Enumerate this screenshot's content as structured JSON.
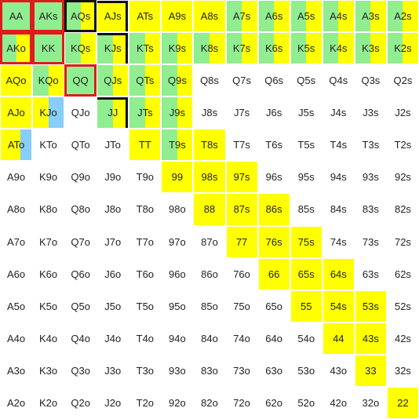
{
  "colors": {
    "yellow": "#ffff00",
    "green": "#90ee90",
    "blue": "#87cefa",
    "white": "#ffffff",
    "red_outline": "#e01b1b",
    "black_outline": "#111111"
  },
  "rows": [
    [
      {
        "label": "AA",
        "fill": [
          "green",
          1.0
        ],
        "outline": "red"
      },
      {
        "label": "AKs",
        "fill": [
          "green",
          1.0
        ],
        "outline": "red"
      },
      {
        "label": "AQs",
        "fill": [
          "green",
          0.5
        ],
        "base": "yellow",
        "outline": "black"
      },
      {
        "label": "AJs",
        "fill": null,
        "base": "yellow",
        "outline": "corner"
      },
      {
        "label": "ATs",
        "base": "yellow"
      },
      {
        "label": "A9s",
        "base": "yellow"
      },
      {
        "label": "A8s",
        "base": "yellow"
      },
      {
        "label": "A7s",
        "fill": [
          "green",
          0.5
        ],
        "base": "yellow"
      },
      {
        "label": "A6s",
        "fill": [
          "green",
          0.5
        ],
        "base": "yellow"
      },
      {
        "label": "A5s",
        "fill": [
          "green",
          0.5
        ],
        "base": "yellow"
      },
      {
        "label": "A4s",
        "fill": [
          "green",
          0.5
        ],
        "base": "yellow"
      },
      {
        "label": "A3s",
        "fill": [
          "green",
          0.5
        ],
        "base": "yellow"
      },
      {
        "label": "A2s",
        "fill": [
          "green",
          0.5
        ],
        "base": "yellow"
      }
    ],
    [
      {
        "label": "AKo",
        "fill": [
          "green",
          0.5
        ],
        "base": "yellow",
        "outline": "red"
      },
      {
        "label": "KK",
        "fill": [
          "green",
          1.0
        ],
        "outline": "red"
      },
      {
        "label": "KQs",
        "fill": [
          "green",
          0.5
        ],
        "base": "yellow"
      },
      {
        "label": "KJs",
        "fill": [
          "green",
          0.5
        ],
        "base": "yellow",
        "outline": "corner"
      },
      {
        "label": "KTs",
        "fill": [
          "green",
          0.5
        ],
        "base": "yellow"
      },
      {
        "label": "K9s",
        "fill": [
          "green",
          0.5
        ],
        "base": "yellow"
      },
      {
        "label": "K8s",
        "fill": [
          "green",
          0.5
        ],
        "base": "yellow"
      },
      {
        "label": "K7s",
        "fill": [
          "green",
          0.5
        ],
        "base": "yellow"
      },
      {
        "label": "K6s",
        "fill": [
          "green",
          0.5
        ],
        "base": "yellow"
      },
      {
        "label": "K5s",
        "fill": [
          "green",
          0.5
        ],
        "base": "yellow"
      },
      {
        "label": "K4s",
        "fill": [
          "green",
          0.5
        ],
        "base": "yellow"
      },
      {
        "label": "K3s",
        "fill": [
          "green",
          0.5
        ],
        "base": "yellow"
      },
      {
        "label": "K2s",
        "fill": [
          "green",
          0.5
        ],
        "base": "yellow"
      }
    ],
    [
      {
        "label": "AQo",
        "base": "yellow"
      },
      {
        "label": "KQo",
        "fill": [
          "green",
          0.5
        ],
        "base": "yellow"
      },
      {
        "label": "QQ",
        "fill": [
          "green",
          1.0
        ],
        "outline": "red"
      },
      {
        "label": "QJs",
        "fill": [
          "green",
          0.5
        ],
        "base": "yellow"
      },
      {
        "label": "QTs",
        "fill": [
          "green",
          0.5
        ],
        "base": "yellow"
      },
      {
        "label": "Q9s",
        "fill": [
          "green",
          0.5
        ],
        "base": "yellow"
      },
      {
        "label": "Q8s"
      },
      {
        "label": "Q7s"
      },
      {
        "label": "Q6s"
      },
      {
        "label": "Q5s"
      },
      {
        "label": "Q4s"
      },
      {
        "label": "Q3s"
      },
      {
        "label": "Q2s"
      }
    ],
    [
      {
        "label": "AJo",
        "base": "yellow"
      },
      {
        "label": "KJo",
        "fill": [
          "blue",
          0.5
        ],
        "base": "yellow",
        "fill_side": "right"
      },
      {
        "label": "QJo"
      },
      {
        "label": "JJ",
        "fill": [
          "green",
          0.5
        ],
        "base": "yellow",
        "outline": "corner"
      },
      {
        "label": "JTs",
        "fill": [
          "green",
          0.5
        ],
        "base": "yellow"
      },
      {
        "label": "J9s",
        "fill": [
          "green",
          0.5
        ],
        "base": "yellow"
      },
      {
        "label": "J8s"
      },
      {
        "label": "J7s"
      },
      {
        "label": "J6s"
      },
      {
        "label": "J5s"
      },
      {
        "label": "J4s"
      },
      {
        "label": "J3s"
      },
      {
        "label": "J2s"
      }
    ],
    [
      {
        "label": "ATo",
        "fill": [
          "blue",
          0.35
        ],
        "base": "yellow",
        "fill_side": "right"
      },
      {
        "label": "KTo"
      },
      {
        "label": "QTo"
      },
      {
        "label": "JTo"
      },
      {
        "label": "TT",
        "base": "yellow"
      },
      {
        "label": "T9s",
        "fill": [
          "green",
          0.5
        ],
        "base": "yellow"
      },
      {
        "label": "T8s",
        "base": "yellow"
      },
      {
        "label": "T7s"
      },
      {
        "label": "T6s"
      },
      {
        "label": "T5s"
      },
      {
        "label": "T4s"
      },
      {
        "label": "T3s"
      },
      {
        "label": "T2s"
      }
    ],
    [
      {
        "label": "A9o"
      },
      {
        "label": "K9o"
      },
      {
        "label": "Q9o"
      },
      {
        "label": "J9o"
      },
      {
        "label": "T9o"
      },
      {
        "label": "99",
        "base": "yellow"
      },
      {
        "label": "98s",
        "base": "yellow"
      },
      {
        "label": "97s",
        "base": "yellow"
      },
      {
        "label": "96s"
      },
      {
        "label": "95s"
      },
      {
        "label": "94s"
      },
      {
        "label": "93s"
      },
      {
        "label": "92s"
      }
    ],
    [
      {
        "label": "A8o"
      },
      {
        "label": "K8o"
      },
      {
        "label": "Q8o"
      },
      {
        "label": "J8o"
      },
      {
        "label": "T8o"
      },
      {
        "label": "98o"
      },
      {
        "label": "88",
        "base": "yellow"
      },
      {
        "label": "87s",
        "base": "yellow"
      },
      {
        "label": "86s",
        "base": "yellow"
      },
      {
        "label": "85s"
      },
      {
        "label": "84s"
      },
      {
        "label": "83s"
      },
      {
        "label": "82s"
      }
    ],
    [
      {
        "label": "A7o"
      },
      {
        "label": "K7o"
      },
      {
        "label": "Q7o"
      },
      {
        "label": "J7o"
      },
      {
        "label": "T7o"
      },
      {
        "label": "97o"
      },
      {
        "label": "87o"
      },
      {
        "label": "77",
        "base": "yellow"
      },
      {
        "label": "76s",
        "base": "yellow"
      },
      {
        "label": "75s",
        "base": "yellow"
      },
      {
        "label": "74s"
      },
      {
        "label": "73s"
      },
      {
        "label": "72s"
      }
    ],
    [
      {
        "label": "A6o"
      },
      {
        "label": "K6o"
      },
      {
        "label": "Q6o"
      },
      {
        "label": "J6o"
      },
      {
        "label": "T6o"
      },
      {
        "label": "96o"
      },
      {
        "label": "86o"
      },
      {
        "label": "76o"
      },
      {
        "label": "66",
        "base": "yellow"
      },
      {
        "label": "65s",
        "base": "yellow"
      },
      {
        "label": "64s",
        "base": "yellow"
      },
      {
        "label": "63s"
      },
      {
        "label": "62s"
      }
    ],
    [
      {
        "label": "A5o"
      },
      {
        "label": "K5o"
      },
      {
        "label": "Q5o"
      },
      {
        "label": "J5o"
      },
      {
        "label": "T5o"
      },
      {
        "label": "95o"
      },
      {
        "label": "85o"
      },
      {
        "label": "75o"
      },
      {
        "label": "65o"
      },
      {
        "label": "55",
        "base": "yellow"
      },
      {
        "label": "54s",
        "base": "yellow"
      },
      {
        "label": "53s",
        "base": "yellow"
      },
      {
        "label": "52s"
      }
    ],
    [
      {
        "label": "A4o"
      },
      {
        "label": "K4o"
      },
      {
        "label": "Q4o"
      },
      {
        "label": "J4o"
      },
      {
        "label": "T4o"
      },
      {
        "label": "94o"
      },
      {
        "label": "84o"
      },
      {
        "label": "74o"
      },
      {
        "label": "64o"
      },
      {
        "label": "54o"
      },
      {
        "label": "44",
        "base": "yellow"
      },
      {
        "label": "43s",
        "base": "yellow"
      },
      {
        "label": "42s"
      }
    ],
    [
      {
        "label": "A3o"
      },
      {
        "label": "K3o"
      },
      {
        "label": "Q3o"
      },
      {
        "label": "J3o"
      },
      {
        "label": "T3o"
      },
      {
        "label": "93o"
      },
      {
        "label": "83o"
      },
      {
        "label": "73o"
      },
      {
        "label": "63o"
      },
      {
        "label": "53o"
      },
      {
        "label": "43o"
      },
      {
        "label": "33",
        "base": "yellow"
      },
      {
        "label": "32s"
      }
    ],
    [
      {
        "label": "A2o"
      },
      {
        "label": "K2o"
      },
      {
        "label": "Q2o"
      },
      {
        "label": "J2o"
      },
      {
        "label": "T2o"
      },
      {
        "label": "92o"
      },
      {
        "label": "82o"
      },
      {
        "label": "72o"
      },
      {
        "label": "62o"
      },
      {
        "label": "52o"
      },
      {
        "label": "42o"
      },
      {
        "label": "32o"
      },
      {
        "label": "22",
        "base": "yellow"
      }
    ]
  ]
}
